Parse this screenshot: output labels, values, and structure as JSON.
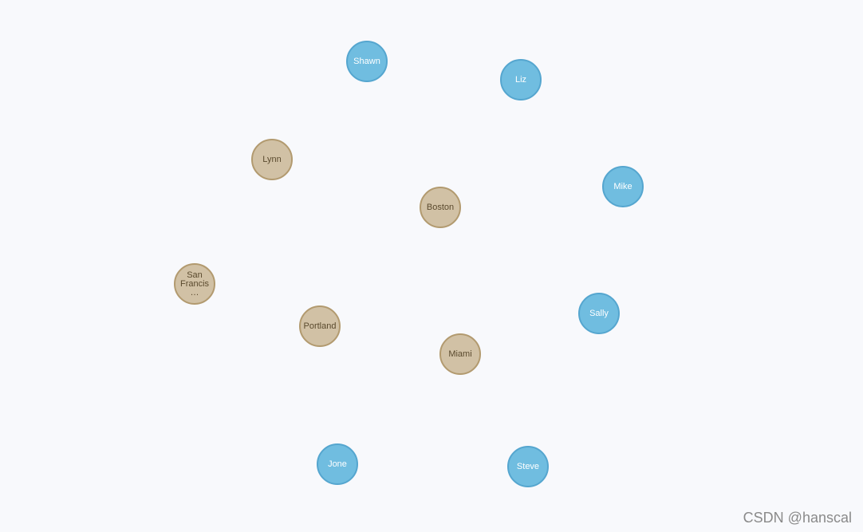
{
  "graph": {
    "nodes": [
      {
        "id": "shawn",
        "label": "Shawn",
        "type": "person"
      },
      {
        "id": "liz",
        "label": "Liz",
        "type": "person"
      },
      {
        "id": "lynn",
        "label": "Lynn",
        "type": "city"
      },
      {
        "id": "mike",
        "label": "Mike",
        "type": "person"
      },
      {
        "id": "boston",
        "label": "Boston",
        "type": "city"
      },
      {
        "id": "san-francisco",
        "label": "San Francis…",
        "type": "city"
      },
      {
        "id": "sally",
        "label": "Sally",
        "type": "person"
      },
      {
        "id": "portland",
        "label": "Portland",
        "type": "city"
      },
      {
        "id": "miami",
        "label": "Miami",
        "type": "city"
      },
      {
        "id": "jone",
        "label": "Jone",
        "type": "person"
      },
      {
        "id": "steve",
        "label": "Steve",
        "type": "person"
      }
    ],
    "colors": {
      "person_fill": "#70bde0",
      "person_stroke": "#55a6cf",
      "city_fill": "#d1c1a5",
      "city_stroke": "#b29a6f",
      "background": "#f8f9fc"
    }
  },
  "watermark": "CSDN @hanscal"
}
